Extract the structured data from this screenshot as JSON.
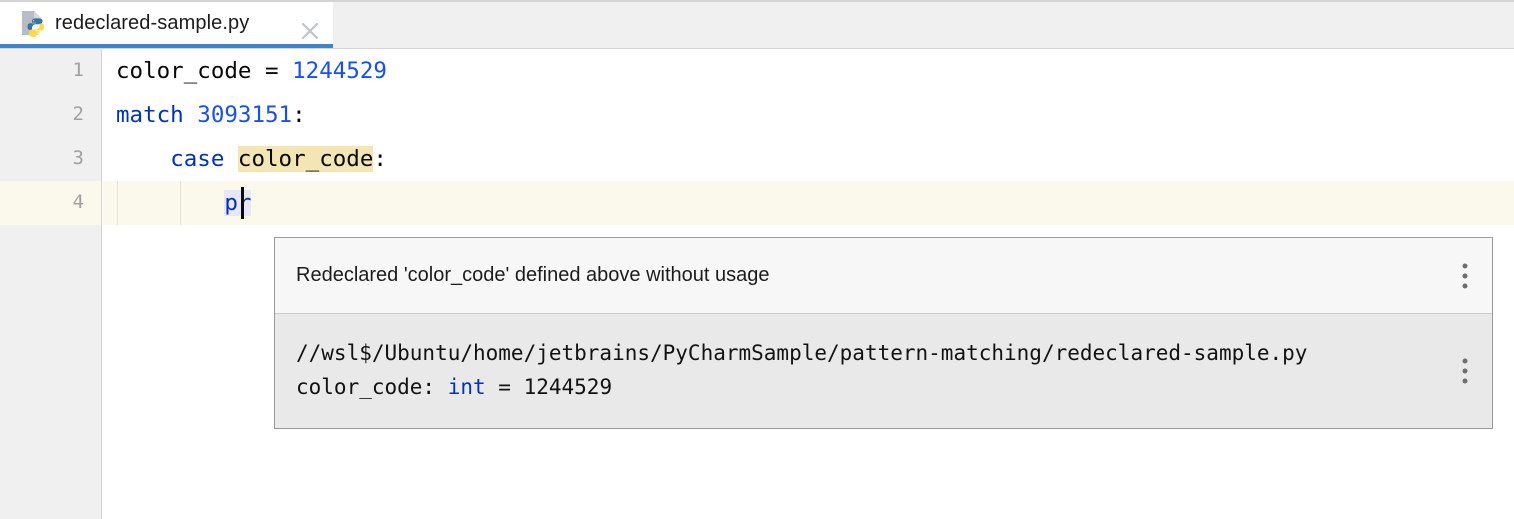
{
  "tab": {
    "filename": "redeclared-sample.py",
    "icon": "python-file-icon",
    "close_icon": "close-icon"
  },
  "editor": {
    "line_numbers": [
      "1",
      "2",
      "3",
      "4"
    ],
    "lines": [
      {
        "number": "1",
        "tokens": [
          {
            "text": "color_code",
            "type": "plain"
          },
          {
            "text": " = ",
            "type": "plain"
          },
          {
            "text": "1244529",
            "type": "num"
          }
        ]
      },
      {
        "number": "2",
        "tokens": [
          {
            "text": "match",
            "type": "kw"
          },
          {
            "text": " ",
            "type": "plain"
          },
          {
            "text": "3093151",
            "type": "num"
          },
          {
            "text": ":",
            "type": "plain"
          }
        ]
      },
      {
        "number": "3",
        "tokens": [
          {
            "text": "    ",
            "type": "plain"
          },
          {
            "text": "case",
            "type": "kw"
          },
          {
            "text": " ",
            "type": "plain"
          },
          {
            "text": "color_code",
            "type": "ident-hl"
          },
          {
            "text": ":",
            "type": "plain"
          }
        ]
      },
      {
        "number": "4",
        "tokens": [
          {
            "text": "        ",
            "type": "plain"
          },
          {
            "text": "pr",
            "type": "kw-sel"
          }
        ]
      }
    ],
    "line1_text": "color_code = 1244529",
    "line2_text": "match 3093151:",
    "line3_text": "    case color_code:",
    "line4_text": "        pr"
  },
  "popup": {
    "title": "Redeclared 'color_code' defined above without usage",
    "file_path": "//wsl$/Ubuntu/home/jetbrains/PyCharmSample/pattern-matching/redeclared-sample.py",
    "code_declaration": "color_code: int = 1244529",
    "code_parts": {
      "name": "color_code: ",
      "type": "int",
      "assign": " = ",
      "value": "1244529"
    },
    "menu_icon_top": "more-options-icon",
    "menu_icon_bottom": "more-options-icon"
  },
  "colors": {
    "tab_underline": "#4083c9",
    "keyword": "#0033b3",
    "number": "#1750eb",
    "identifier_highlight": "#f3e5b4",
    "line_highlight": "#fbf8ec",
    "selection": "#e8e6fb"
  }
}
